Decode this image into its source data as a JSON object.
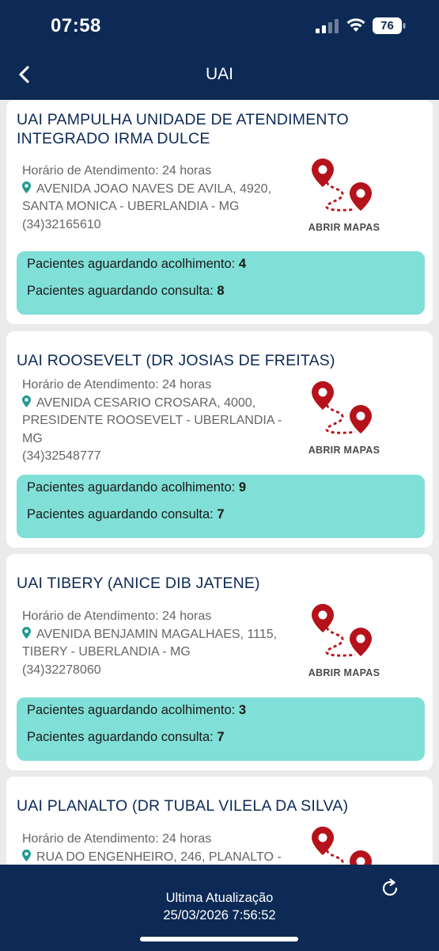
{
  "status_bar": {
    "time": "07:58",
    "battery": "76"
  },
  "nav": {
    "title": "UAI"
  },
  "labels": {
    "hours_prefix": "Horário de Atendimento: ",
    "map_button": "ABRIR MAPAS",
    "waiting_reception": "Pacientes aguardando acolhimento: ",
    "waiting_consult": "Pacientes aguardando consulta: "
  },
  "units": [
    {
      "name_line1": "UAI PAMPULHA UNIDADE DE ATENDIMENTO",
      "name_line2": "INTEGRADO IRMA DULCE",
      "hours": "24 horas",
      "address_line1": "AVENIDA JOAO NAVES DE AVILA, 4920,",
      "address_line2": "SANTA MONICA - UBERLANDIA - MG",
      "address_line3": "",
      "phone": "(34)32165610",
      "waiting_reception": "4",
      "waiting_consult": "8"
    },
    {
      "name_line1": "UAI ROOSEVELT (DR JOSIAS DE FREITAS)",
      "name_line2": "",
      "hours": "24 horas",
      "address_line1": "AVENIDA CESARIO CROSARA, 4000,",
      "address_line2": "PRESIDENTE ROOSEVELT - UBERLANDIA -",
      "address_line3": "MG",
      "phone": "(34)32548777",
      "waiting_reception": "9",
      "waiting_consult": "7"
    },
    {
      "name_line1": "UAI TIBERY (ANICE DIB JATENE)",
      "name_line2": "",
      "hours": "24 horas",
      "address_line1": "AVENIDA BENJAMIN MAGALHAES, 1115,",
      "address_line2": "TIBERY - UBERLANDIA - MG",
      "address_line3": "",
      "phone": "(34)32278060",
      "waiting_reception": "3",
      "waiting_consult": "7"
    },
    {
      "name_line1": "UAI PLANALTO (DR TUBAL VILELA DA SILVA)",
      "name_line2": "",
      "hours": "24 horas",
      "address_line1": "RUA DO ENGENHEIRO, 246, PLANALTO -"
    }
  ],
  "footer": {
    "label": "Ultima Atualização",
    "timestamp": "25/03/2026 7:56:52"
  },
  "colors": {
    "primary": "#0c2a55",
    "accent": "#80dfd6",
    "pin": "#b5121b"
  },
  "icons": [
    "back-chevron-icon",
    "location-pin-icon",
    "route-map-icon",
    "refresh-icon"
  ]
}
